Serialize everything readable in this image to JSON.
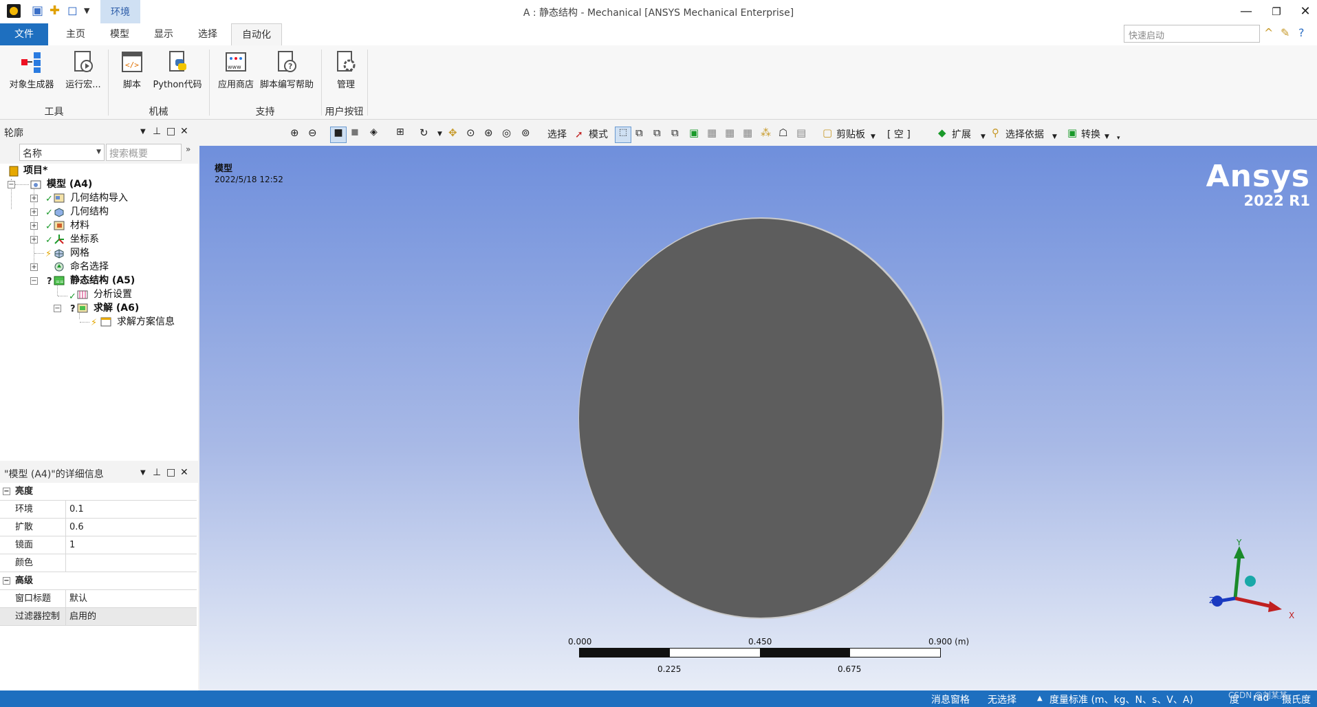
{
  "titlebar": {
    "title": "A : 静态结构 - Mechanical [ANSYS Mechanical Enterprise]",
    "context_tab": "环境"
  },
  "ribbon_tabs": [
    "文件",
    "主页",
    "模型",
    "显示",
    "选择",
    "自动化"
  ],
  "quick_launch": {
    "placeholder": "快速启动"
  },
  "ribbon": {
    "buttons": [
      "对象生成器",
      "运行宏...",
      "脚本",
      "Python代码",
      "应用商店",
      "脚本编写帮助",
      "管理"
    ],
    "groups": [
      "工具",
      "机械",
      "支持",
      "用户按钮"
    ]
  },
  "outline": {
    "title": "轮廓",
    "filter_name": "名称",
    "search_placeholder": "搜索概要",
    "nodes": [
      {
        "label": "项目*"
      },
      {
        "label": "模型 (A4)"
      },
      {
        "label": "几何结构导入"
      },
      {
        "label": "几何结构"
      },
      {
        "label": "材料"
      },
      {
        "label": "坐标系"
      },
      {
        "label": "网格"
      },
      {
        "label": "命名选择"
      },
      {
        "label": "静态结构 (A5)"
      },
      {
        "label": "分析设置"
      },
      {
        "label": "求解 (A6)"
      },
      {
        "label": "求解方案信息"
      }
    ]
  },
  "details": {
    "title": "\"模型 (A4)\"的详细信息",
    "rows": [
      {
        "key": "亮度",
        "value": ""
      },
      {
        "key": "环境",
        "value": "0.1"
      },
      {
        "key": "扩散",
        "value": "0.6"
      },
      {
        "key": "镜面",
        "value": "1"
      },
      {
        "key": "颜色",
        "value": ""
      },
      {
        "key": "高级",
        "value": ""
      },
      {
        "key": "窗口标题",
        "value": "默认"
      },
      {
        "key": "过滤器控制",
        "value": "启用的"
      }
    ]
  },
  "graphics_toolbar": {
    "select": "选择",
    "mode": "模式",
    "clipboard": "剪贴板",
    "empty": "[ 空 ]",
    "expand": "扩展",
    "select_by": "选择依据",
    "convert": "转换"
  },
  "viewport": {
    "title": "模型",
    "date": "2022/5/18 12:52",
    "brand": "Ansys",
    "version": "2022 R1",
    "scale_top": [
      "0.000",
      "0.450",
      "0.900 (m)"
    ],
    "scale_bottom": [
      "0.225",
      "0.675"
    ],
    "axes": {
      "x": "X",
      "y": "Y",
      "z": "Z"
    }
  },
  "statusbar": {
    "messages": "消息窗格",
    "selection": "无选择",
    "units": "度量标准 (m、kg、N、s、V、A)",
    "angle": "度",
    "rad": "rad",
    "temp": "摄氏度",
    "watermark": "CSDN @刘某某"
  },
  "colors": {
    "accent": "#1e6fbf",
    "viewport_top": "#6f8fdc",
    "viewport_bottom": "#e8edf7",
    "model": "#5d5d5d"
  }
}
